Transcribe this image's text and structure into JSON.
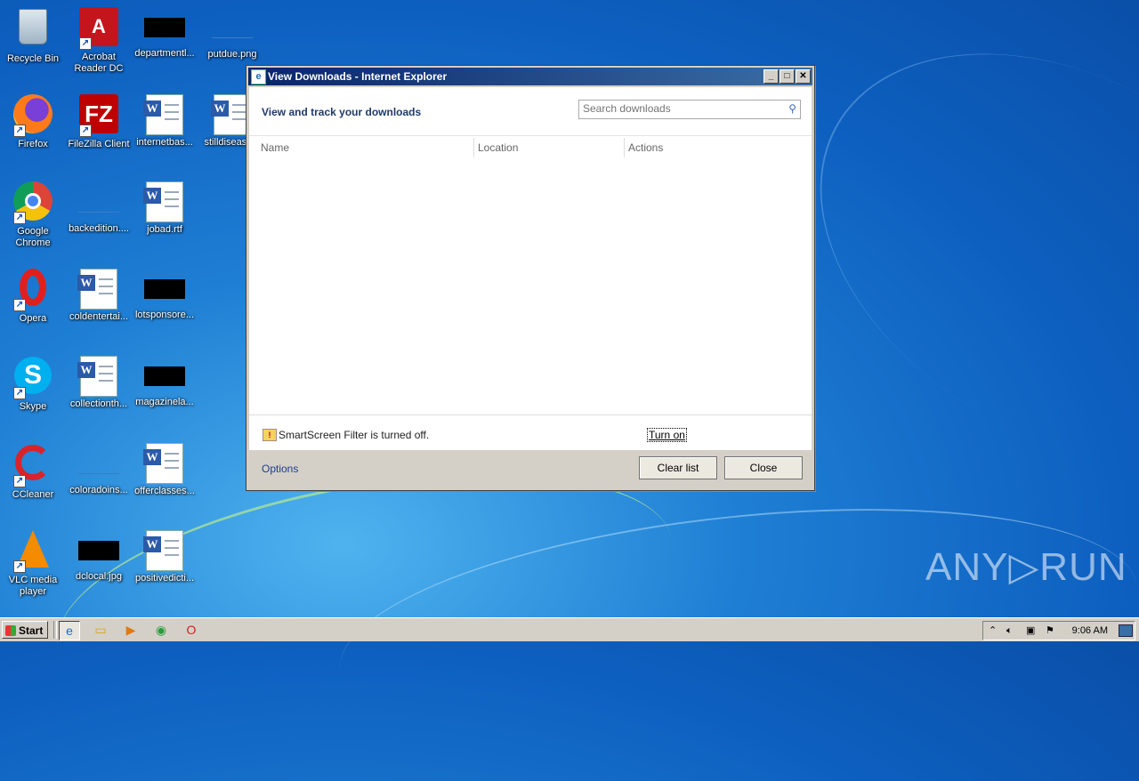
{
  "desktop": {
    "icons": [
      {
        "label": "Recycle Bin",
        "icon": "recycle-bin-icon"
      },
      {
        "label": "Acrobat Reader DC",
        "icon": "acrobat-icon"
      },
      {
        "label": "departmentl...",
        "icon": "redacted-thumbnail"
      },
      {
        "label": "putdue.png",
        "icon": "image-file-icon"
      },
      {
        "label": "Firefox",
        "icon": "firefox-icon"
      },
      {
        "label": "FileZilla Client",
        "icon": "filezilla-icon"
      },
      {
        "label": "internetbas...",
        "icon": "word-doc-icon"
      },
      {
        "label": "stilldisease...",
        "icon": "word-doc-icon"
      },
      {
        "label": "Google Chrome",
        "icon": "chrome-icon"
      },
      {
        "label": "backedition....",
        "icon": "image-file-icon"
      },
      {
        "label": "jobad.rtf",
        "icon": "word-doc-icon"
      },
      {
        "label": "Opera",
        "icon": "opera-icon"
      },
      {
        "label": "coldentertai...",
        "icon": "word-doc-icon"
      },
      {
        "label": "lotsponsore...",
        "icon": "redacted-thumbnail"
      },
      {
        "label": "Skype",
        "icon": "skype-icon"
      },
      {
        "label": "collectionth...",
        "icon": "word-doc-icon"
      },
      {
        "label": "magazinela...",
        "icon": "redacted-thumbnail"
      },
      {
        "label": "CCleaner",
        "icon": "ccleaner-icon"
      },
      {
        "label": "coloradoins...",
        "icon": "image-file-icon"
      },
      {
        "label": "offerclasses...",
        "icon": "word-doc-icon"
      },
      {
        "label": "VLC media player",
        "icon": "vlc-icon"
      },
      {
        "label": "dclocal.jpg",
        "icon": "redacted-thumbnail"
      },
      {
        "label": "positivedicti...",
        "icon": "word-doc-icon"
      }
    ]
  },
  "window": {
    "title": "View Downloads - Internet Explorer",
    "min_glyph": "_",
    "max_glyph": "□",
    "close_glyph": "✕",
    "heading": "View and track your downloads",
    "search_placeholder": "Search downloads",
    "columns": [
      "Name",
      "Location",
      "Actions"
    ],
    "smartscreen_message": "SmartScreen Filter is turned off.",
    "turn_on_label": "Turn on",
    "options_label": "Options",
    "clear_list_label": "Clear list",
    "close_label": "Close"
  },
  "taskbar": {
    "start_label": "Start",
    "clock": "9:06 AM",
    "tray_icons": [
      "chevron-up-icon",
      "speaker-icon",
      "network-icon",
      "flag-icon"
    ]
  },
  "watermark": "ANY▷RUN"
}
